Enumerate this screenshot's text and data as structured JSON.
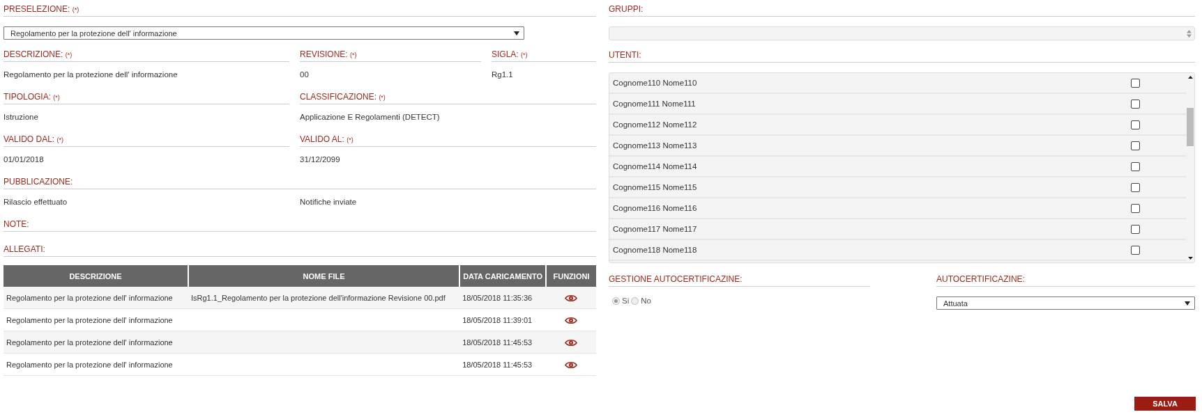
{
  "preselezione": {
    "label": "PRESELEZIONE:",
    "required": "(*)",
    "value": "Regolamento per la protezione dell' informazione"
  },
  "field_rows": [
    [
      {
        "label": "DESCRIZIONE:",
        "required": "(*)",
        "values": [
          "Regolamento per la protezione dell' informazione"
        ]
      },
      {
        "label": "REVISIONE:",
        "required": "(*)",
        "values": [
          "00"
        ]
      },
      {
        "label": "SIGLA:",
        "required": "(*)",
        "values": [
          "Rg1.1"
        ]
      }
    ],
    [
      {
        "label": "TIPOLOGIA:",
        "required": "(*)",
        "values": [
          "Istruzione"
        ]
      },
      {
        "label": "CLASSIFICAZIONE:",
        "required": "(*)",
        "values": [
          "Applicazione E Regolamenti (DETECT)"
        ]
      }
    ],
    [
      {
        "label": "VALIDO DAL:",
        "required": "(*)",
        "values": [
          "01/01/2018"
        ]
      },
      {
        "label": "VALIDO AL:",
        "required": "(*)",
        "values": [
          "31/12/2099"
        ]
      }
    ],
    [
      {
        "label": "PUBBLICAZIONE:",
        "values": [
          "Rilascio effettuato",
          "Notifiche inviate"
        ]
      }
    ],
    [
      {
        "label": "NOTE:"
      }
    ]
  ],
  "allegati": {
    "label": "ALLEGATI:",
    "columns": [
      "DESCRIZIONE",
      "NOME FILE",
      "DATA CARICAMENTO",
      "FUNZIONI"
    ],
    "rows": [
      {
        "descrizione": "Regolamento per la protezione dell' informazione",
        "nome_file": "IsRg1.1_Regolamento per la protezione dell'informazione Revisione 00.pdf",
        "data": "18/05/2018 11:35:36"
      },
      {
        "descrizione": "Regolamento per la protezione dell' informazione",
        "nome_file": "",
        "data": "18/05/2018 11:39:01"
      },
      {
        "descrizione": "Regolamento per la protezione dell' informazione",
        "nome_file": "",
        "data": "18/05/2018 11:45:53"
      },
      {
        "descrizione": "Regolamento per la protezione dell' informazione",
        "nome_file": "",
        "data": "18/05/2018 11:45:53"
      }
    ]
  },
  "gruppi": {
    "label": "GRUPPI:"
  },
  "utenti": {
    "label": "UTENTI:",
    "users": [
      {
        "name": "Cognome110 Nome110",
        "checked": false
      },
      {
        "name": "Cognome111 Nome111",
        "checked": false
      },
      {
        "name": "Cognome112 Nome112",
        "checked": false
      },
      {
        "name": "Cognome113 Nome113",
        "checked": false
      },
      {
        "name": "Cognome114 Nome114",
        "checked": false
      },
      {
        "name": "Cognome115 Nome115",
        "checked": false
      },
      {
        "name": "Cognome116 Nome116",
        "checked": false
      },
      {
        "name": "Cognome117 Nome117",
        "checked": false
      },
      {
        "name": "Cognome118 Nome118",
        "checked": false
      }
    ]
  },
  "gestione_autocertificazine": {
    "label": "GESTIONE AUTOCERTIFICAZINE:",
    "disabled": true,
    "options": [
      {
        "label": "Si",
        "selected": true
      },
      {
        "label": "No",
        "selected": false
      }
    ]
  },
  "autocertificazine": {
    "label": "AUTOCERTIFICAZINE:",
    "value": "Attuata"
  },
  "save_button": "SALVA"
}
